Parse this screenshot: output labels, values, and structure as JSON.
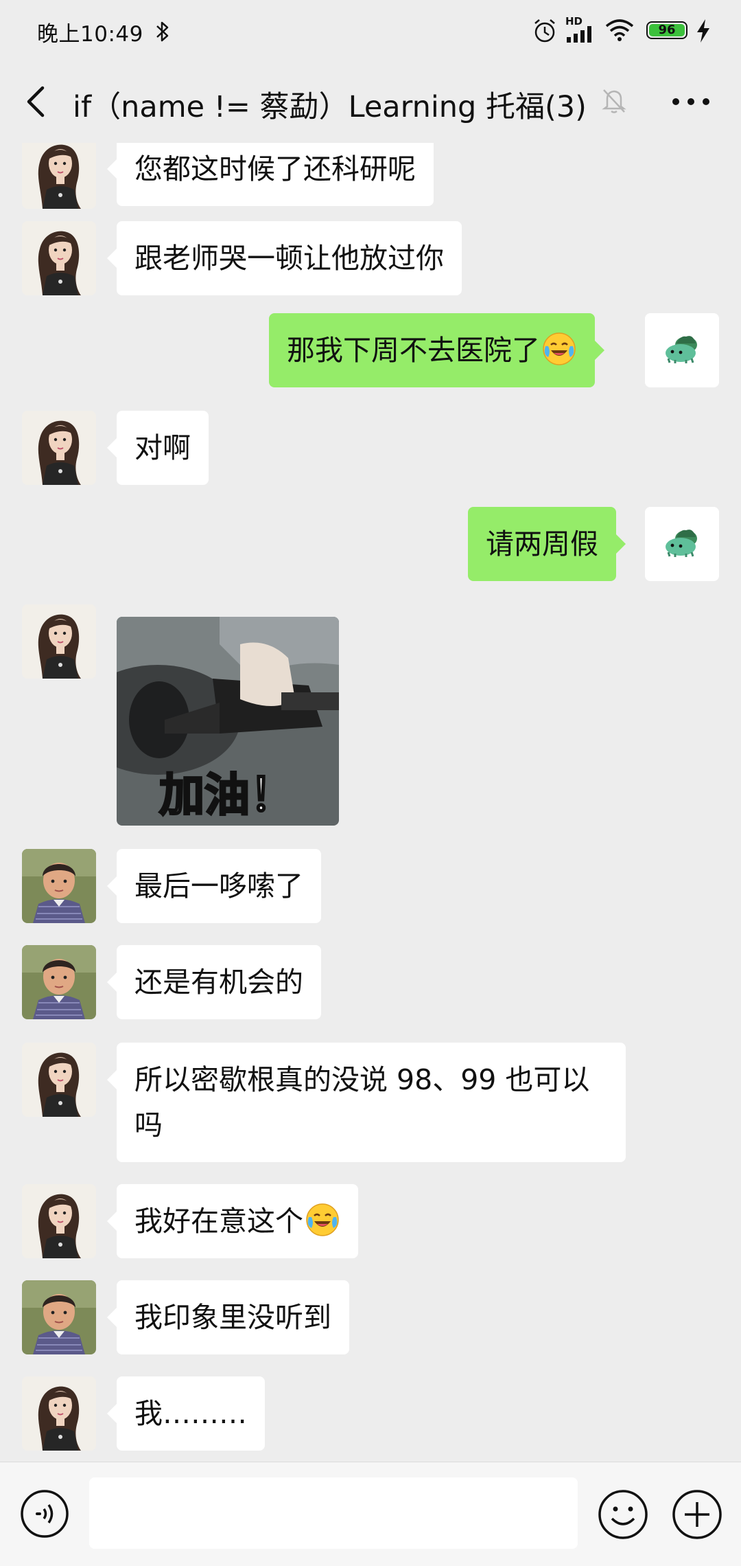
{
  "status_bar": {
    "time": "晚上10:49",
    "battery_level": "96",
    "network_label": "HD",
    "icons": [
      "bluetooth-icon",
      "alarm-icon",
      "signal-icon",
      "wifi-icon",
      "battery-icon",
      "charging-icon"
    ]
  },
  "header": {
    "title": "if（name != 蔡勐）Learning 托福(3)",
    "icons": [
      "back-arrow-icon",
      "mute-bell-icon",
      "more-dots-icon"
    ]
  },
  "messages": [
    {
      "direction": "in",
      "sender_avatar": "girl-avatar",
      "text": "您都这时候了还科研呢"
    },
    {
      "direction": "in",
      "sender_avatar": "girl-avatar",
      "text": "跟老师哭一顿让他放过你"
    },
    {
      "direction": "out",
      "sender_avatar": "bulbasaur-avatar",
      "text": "那我下周不去医院了",
      "emoji": "crying-laughing-emoji"
    },
    {
      "direction": "in",
      "sender_avatar": "girl-avatar",
      "text": "对啊"
    },
    {
      "direction": "out",
      "sender_avatar": "bulbasaur-avatar",
      "text": "请两周假"
    },
    {
      "direction": "in",
      "sender_avatar": "girl-avatar",
      "type": "sticker",
      "sticker_caption": "加油！"
    },
    {
      "direction": "in",
      "sender_avatar": "boy-avatar",
      "text": "最后一哆嗦了"
    },
    {
      "direction": "in",
      "sender_avatar": "boy-avatar",
      "text": "还是有机会的"
    },
    {
      "direction": "in",
      "sender_avatar": "girl-avatar",
      "text": "所以密歇根真的没说 98、99 也可以吗"
    },
    {
      "direction": "in",
      "sender_avatar": "girl-avatar",
      "text": "我好在意这个",
      "emoji": "crying-laughing-emoji"
    },
    {
      "direction": "in",
      "sender_avatar": "boy-avatar",
      "text": "我印象里没听到"
    },
    {
      "direction": "in",
      "sender_avatar": "girl-avatar",
      "text": "我………"
    }
  ],
  "input_bar": {
    "placeholder": "",
    "icons": [
      "voice-icon",
      "emoji-face-icon",
      "plus-icon"
    ]
  },
  "colors": {
    "background": "#ededed",
    "incoming_bubble": "#ffffff",
    "outgoing_bubble": "#95ec69",
    "battery_green": "#3cc13c"
  }
}
